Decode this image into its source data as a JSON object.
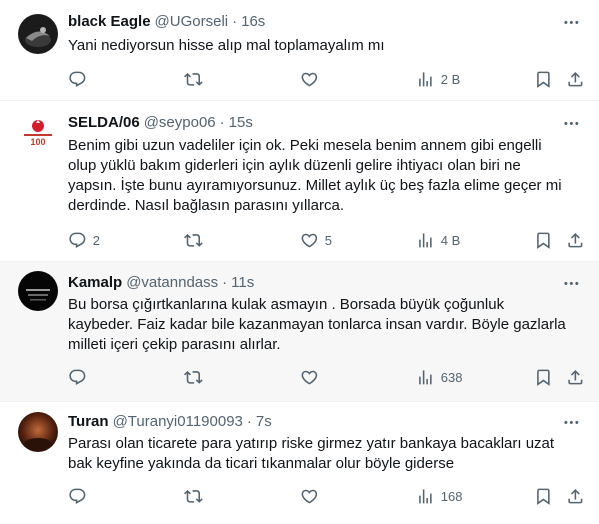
{
  "tweets": [
    {
      "name": "black Eagle",
      "handle": "@UGorseli",
      "dot": "·",
      "time": "16s",
      "text": "Yani nediyorsun hisse alıp mal toplamayalım mı",
      "replies": "",
      "retweets": "",
      "likes": "",
      "views": "2 B"
    },
    {
      "name": "SELDA/06",
      "handle": "@seypo06",
      "dot": "·",
      "time": "15s",
      "text": "Benim gibi uzun vadeliler için ok. Peki mesela benim annem gibi engelli\nolup yüklü bakım giderleri için aylık düzenli gelire ihtiyacı olan biri ne\nyapsın. İşte bunu ayıramıyorsunuz. Millet aylık üç beş fazla elime geçer mi\nderdinde. Nasıl bağlasın parasını yıllarca.",
      "replies": "2",
      "retweets": "",
      "likes": "5",
      "views": "4 B"
    },
    {
      "name": "Kamalp",
      "handle": "@vatanndass",
      "dot": "·",
      "time": "11s",
      "text": "Bu borsa çığırtkanlarına kulak asmayın . Borsada büyük çoğunluk\nkaybeder. Faiz kadar bile kazanmayan tonlarca insan vardır. Böyle gazlarla\nmilleti içeri çekip parasını alırlar.",
      "replies": "",
      "retweets": "",
      "likes": "",
      "views": "638"
    },
    {
      "name": "Turan",
      "handle": "@Turanyi01190093",
      "dot": "·",
      "time": "7s",
      "text": "Parası olan ticarete para yatırıp riske girmez yatır bankaya bacakları uzat\nbak keyfine  yakında da ticari tıkanmalar olur böyle giderse",
      "replies": "",
      "retweets": "",
      "likes": "",
      "views": "168"
    }
  ],
  "colors": {
    "text": "#0f1419",
    "secondary": "#536471",
    "divider": "#eff3f4",
    "hover_bg": "#f7f7f7"
  },
  "icons": [
    "reply-icon",
    "retweet-icon",
    "like-icon",
    "views-icon",
    "bookmark-icon",
    "share-icon",
    "more-icon"
  ]
}
